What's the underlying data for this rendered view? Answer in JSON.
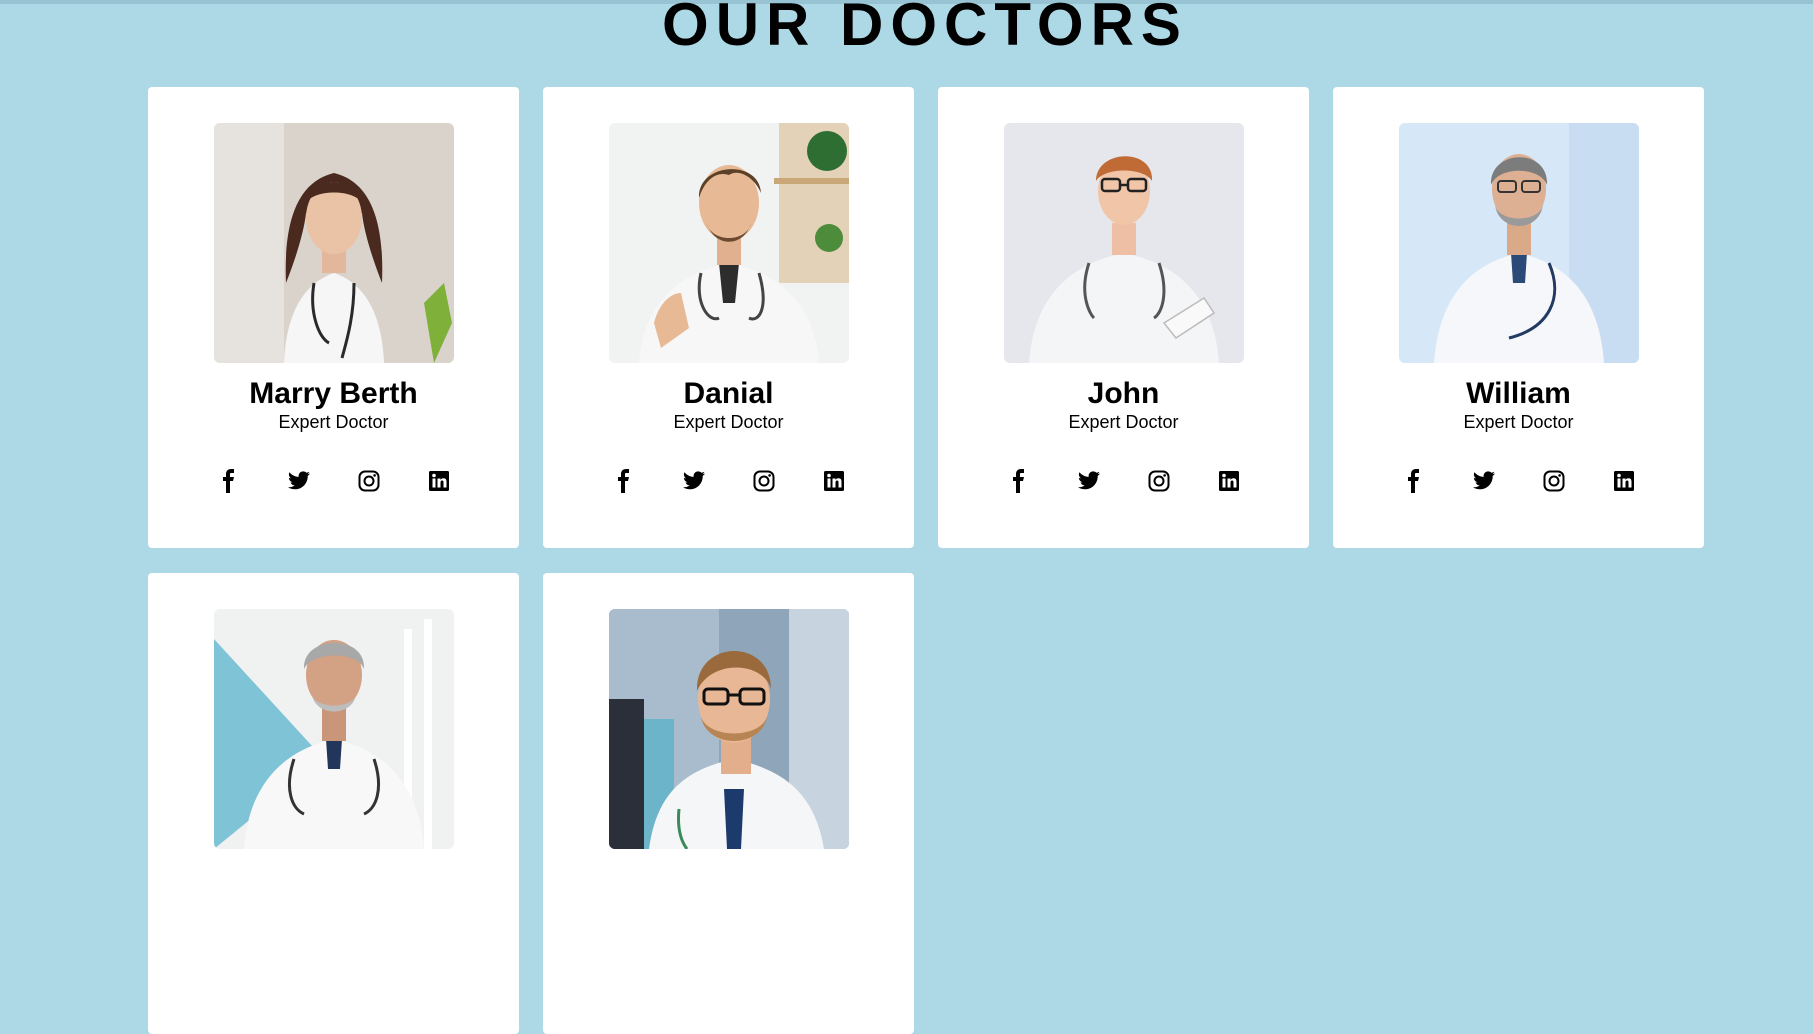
{
  "page": {
    "title": "OUR DOCTORS"
  },
  "colors": {
    "background": "#add8e6",
    "card": "#ffffff",
    "text": "#000000"
  },
  "doctors": [
    {
      "name": "Marry Berth",
      "role": "Expert Doctor",
      "photo": "female-doctor-photo"
    },
    {
      "name": "Danial",
      "role": "Expert Doctor",
      "photo": "male-doctor-thumbs-up-photo"
    },
    {
      "name": "John",
      "role": "Expert Doctor",
      "photo": "male-doctor-tablet-photo"
    },
    {
      "name": "William",
      "role": "Expert Doctor",
      "photo": "senior-male-doctor-photo"
    },
    {
      "name": "",
      "role": "",
      "photo": "senior-doctor-arms-crossed-photo"
    },
    {
      "name": "",
      "role": "",
      "photo": "male-doctor-glasses-photo"
    }
  ],
  "social_icons": [
    "facebook-icon",
    "twitter-icon",
    "instagram-icon",
    "linkedin-icon"
  ]
}
